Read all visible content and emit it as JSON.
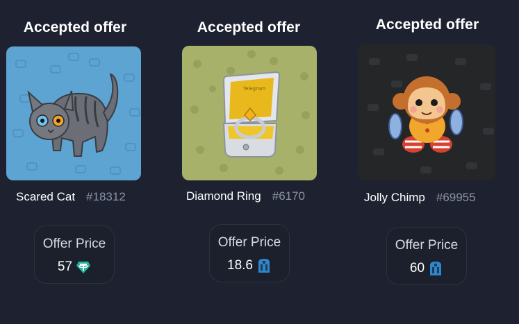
{
  "offers": [
    {
      "title": "Accepted offer",
      "gift_name": "Scared Cat",
      "gift_number": "#18312",
      "price_label": "Offer Price",
      "price_value": "57",
      "currency_icon": "usdt-tether-icon",
      "image_icon": "scared-cat-icon",
      "background_color": "#5ea4d2"
    },
    {
      "title": "Accepted offer",
      "gift_name": "Diamond Ring",
      "gift_number": "#6170",
      "price_label": "Offer Price",
      "price_value": "18.6",
      "currency_icon": "ton-coin-icon",
      "image_icon": "diamond-ring-icon",
      "background_color": "#a7b16a",
      "box_text": "Telegram"
    },
    {
      "title": "Accepted offer",
      "gift_name": "Jolly Chimp",
      "gift_number": "#69955",
      "price_label": "Offer Price",
      "price_value": "60",
      "currency_icon": "ton-coin-icon",
      "image_icon": "jolly-chimp-icon",
      "background_color": "#252628"
    }
  ]
}
